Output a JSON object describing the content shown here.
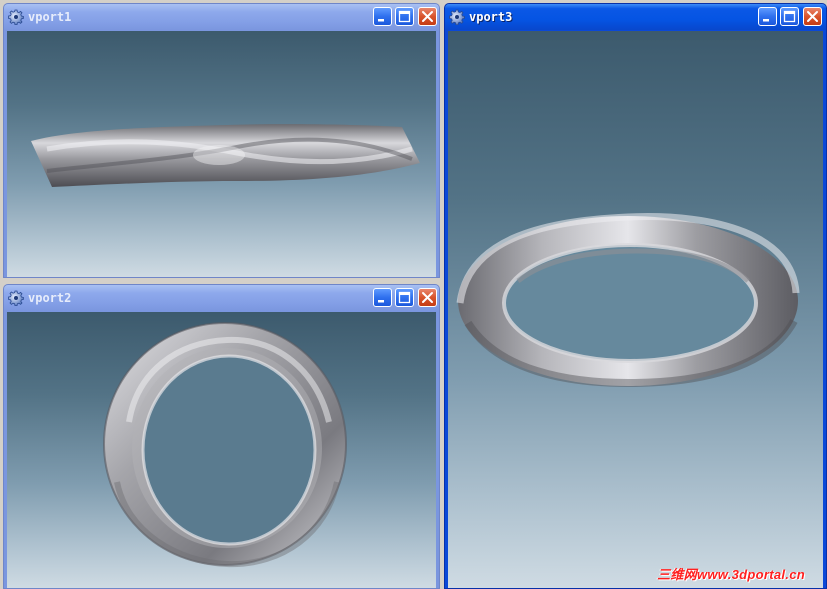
{
  "windows": [
    {
      "id": "vport1",
      "title": "vport1",
      "active": false
    },
    {
      "id": "vport2",
      "title": "vport2",
      "active": false
    },
    {
      "id": "vport3",
      "title": "vport3",
      "active": true
    }
  ],
  "watermark": "三维网www.3dportal.cn",
  "icons": {
    "app": "gear-icon",
    "minimize": "minimize-icon",
    "maximize": "maximize-icon",
    "close": "close-icon"
  },
  "colors": {
    "active_title": "#0554e3",
    "inactive_title": "#839fe6",
    "close_button": "#d9542c",
    "viewport_top": "#3c5a6d",
    "viewport_bottom": "#cfdbe3",
    "ring_metal": "#a9a9ad",
    "watermark": "#ff2020"
  }
}
